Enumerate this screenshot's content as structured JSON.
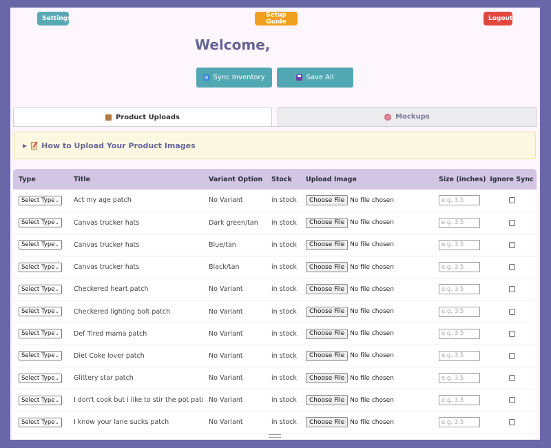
{
  "header": {
    "settings_label": "Settings",
    "setup_label": "Setup Guide",
    "logout_label": "Logout",
    "welcome": "Welcome,"
  },
  "actions": {
    "sync_label": "Sync Inventory",
    "save_label": "Save All"
  },
  "tabs": [
    {
      "label": "Product Uploads",
      "icon": "package-icon",
      "active": true
    },
    {
      "label": "Mockups",
      "icon": "gear-icon",
      "active": false
    }
  ],
  "howto": {
    "label": "How to Upload Your Product Images"
  },
  "table": {
    "headers": {
      "type": "Type",
      "title": "Title",
      "variant": "Variant Option",
      "stock": "Stock",
      "upload": "Upload Image",
      "size": "Size (inches)",
      "ignore": "Ignore Sync"
    },
    "select_label": "Select Type",
    "file_button": "Choose File",
    "file_status": "No file chosen",
    "size_placeholder": "e.g. 3.5",
    "rows": [
      {
        "title": "Act my age patch",
        "variant": "No Variant",
        "stock": "in stock"
      },
      {
        "title": "Canvas trucker hats",
        "variant": "Dark green/tan",
        "stock": "in stock"
      },
      {
        "title": "Canvas trucker hats",
        "variant": "Blue/tan",
        "stock": "in stock"
      },
      {
        "title": "Canvas trucker hats",
        "variant": "Black/tan",
        "stock": "in stock"
      },
      {
        "title": "Checkered heart patch",
        "variant": "No Variant",
        "stock": "in stock"
      },
      {
        "title": "Checkered lighting bolt patch",
        "variant": "No Variant",
        "stock": "in stock"
      },
      {
        "title": "Def Tired mama patch",
        "variant": "No Variant",
        "stock": "in stock"
      },
      {
        "title": "Diet Coke lover patch",
        "variant": "No Variant",
        "stock": "in stock"
      },
      {
        "title": "Glittery star patch",
        "variant": "No Variant",
        "stock": "in stock"
      },
      {
        "title": "I don't cook but i like to stir the pot patch",
        "variant": "No Variant",
        "stock": "in stock"
      },
      {
        "title": "I know your lane sucks patch",
        "variant": "No Variant",
        "stock": "in stock"
      }
    ]
  },
  "colors": {
    "background": "#6a67a8",
    "accent_teal": "#52a8b2",
    "accent_orange": "#f0a01c",
    "accent_red": "#e2473e",
    "table_header": "#d3c5e4"
  }
}
